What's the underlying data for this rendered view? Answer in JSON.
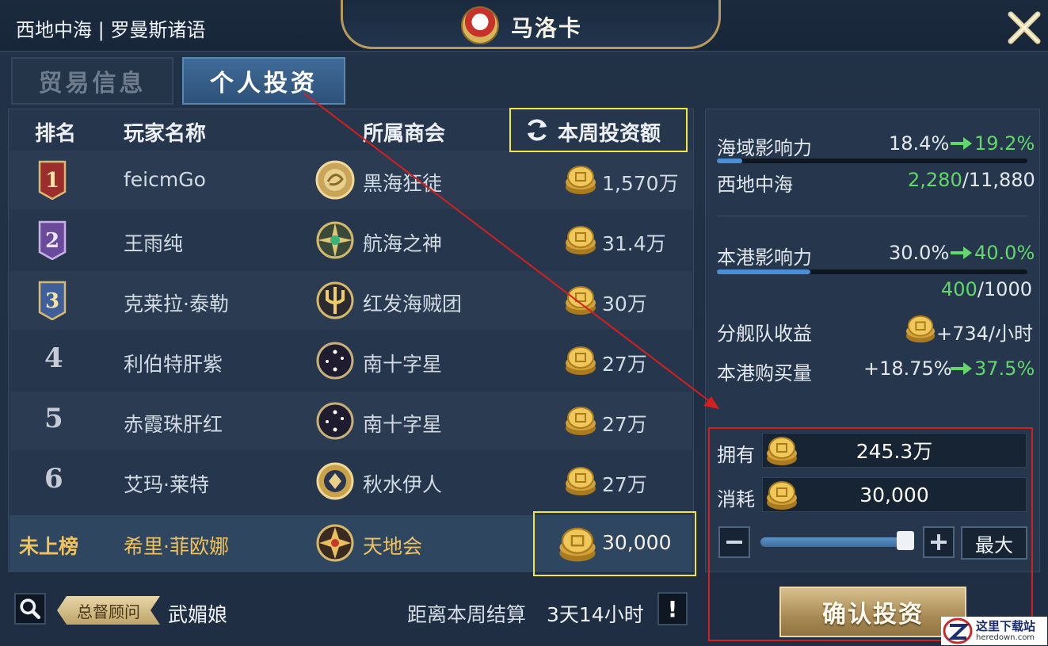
{
  "header": {
    "region": "西地中海 | 罗曼斯诸语",
    "city_name": "马洛卡",
    "close_icon": "close-x-icon"
  },
  "tabs": [
    {
      "label": "贸易信息",
      "active": false
    },
    {
      "label": "个人投资",
      "active": true
    }
  ],
  "table": {
    "headers": {
      "rank": "排名",
      "player": "玩家名称",
      "guild": "所属商会",
      "weekly": "本周投资额"
    },
    "rows": [
      {
        "rank": "1",
        "player": "feicmGo",
        "guild": "黑海狂徒",
        "amount": "1,570万",
        "badge_color": "#9b2d2d",
        "emblem": "gold-dragon-emblem"
      },
      {
        "rank": "2",
        "player": "王雨纯",
        "guild": "航海之神",
        "amount": "31.4万",
        "badge_color": "#6a4a9a",
        "emblem": "compass-star-emblem"
      },
      {
        "rank": "3",
        "player": "克莱拉·泰勒",
        "guild": "红发海贼团",
        "amount": "30万",
        "badge_color": "#3f5f9a",
        "emblem": "trident-emblem"
      },
      {
        "rank": "4",
        "player": "利伯特肝紫",
        "guild": "南十字星",
        "amount": "27万",
        "emblem": "southern-cross-emblem"
      },
      {
        "rank": "5",
        "player": "赤霞珠肝红",
        "guild": "南十字星",
        "amount": "27万",
        "emblem": "southern-cross-emblem"
      },
      {
        "rank": "6",
        "player": "艾玛·莱特",
        "guild": "秋水伊人",
        "amount": "27万",
        "emblem": "diamond-emblem"
      }
    ],
    "mine": {
      "rank": "未上榜",
      "player": "希里·菲欧娜",
      "guild": "天地会",
      "amount": "30,000"
    }
  },
  "bottom": {
    "advisor_tag": "总督顾问",
    "advisor_name": "武媚娘",
    "countdown_label": "距离本周结算",
    "countdown_value": "3天14小时",
    "info": "!"
  },
  "stats": {
    "sea_influence_label": "海域影响力",
    "sea_influence_now": "18.4%",
    "sea_influence_next": "19.2%",
    "sea_influence_progress": 0.184,
    "sea_region": "西地中海",
    "sea_points_current": "2,280",
    "sea_points_total": "/11,880",
    "port_influence_label": "本港影响力",
    "port_influence_now": "30.0%",
    "port_influence_next": "40.0%",
    "port_influence_progress": 0.3,
    "port_influence_next_progress": 0.4,
    "port_points_current": "400",
    "port_points_total": "/1000",
    "fleet_income_label": "分舰队收益",
    "fleet_income_value": "+734/小时",
    "port_purchase_label": "本港购买量",
    "port_purchase_now": "+18.75%",
    "port_purchase_next": "37.5%"
  },
  "invest": {
    "owned_label": "拥有",
    "owned_value": "245.3万",
    "cost_label": "消耗",
    "cost_value": "30,000",
    "slider_level": 0.98,
    "max_label": "最大",
    "confirm_label": "确认投资"
  },
  "watermark": {
    "title": "这里下载站",
    "url": "heredown.com"
  },
  "colors": {
    "accent_gold": "#d8c08e",
    "highlight_yellow": "#f2e83a",
    "annotation_red": "#d41f1f",
    "positive_green": "#63d66c",
    "mine_gold": "#f1c25a"
  }
}
